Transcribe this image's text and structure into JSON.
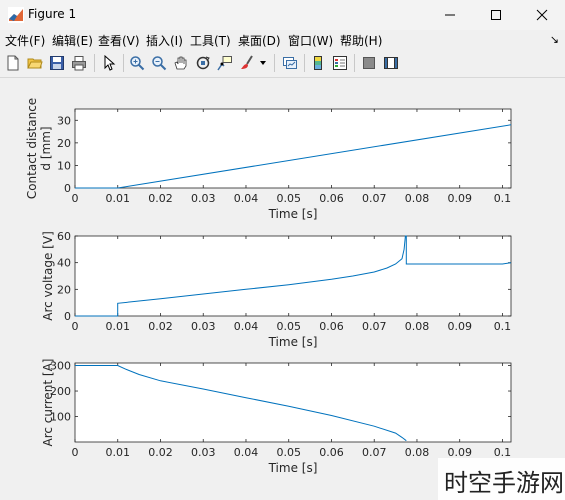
{
  "window": {
    "title": "Figure 1",
    "icon": "matlab-icon"
  },
  "menu": [
    "文件(F)",
    "编辑(E)",
    "查看(V)",
    "插入(I)",
    "工具(T)",
    "桌面(D)",
    "窗口(W)",
    "帮助(H)"
  ],
  "toolbar": [
    "new-figure-icon",
    "open-icon",
    "save-icon",
    "print-icon",
    "pointer-icon",
    "zoom-in-icon",
    "zoom-out-icon",
    "pan-icon",
    "rotate-icon",
    "data-cursor-icon",
    "brush-icon",
    "link-plot-icon",
    "colorbar-icon",
    "legend-icon",
    "hide-plot-tools-icon",
    "show-plot-tools-icon"
  ],
  "colors": {
    "line": "#0072bd",
    "axes_bg": "#ffffff",
    "figure_bg": "#f0f0f0"
  },
  "watermark": "时空手游网",
  "chart_data": [
    {
      "type": "line",
      "xlabel": "Time [s]",
      "ylabel": [
        "Contact distance",
        "d [mm]"
      ],
      "xlim": [
        0,
        0.102
      ],
      "ylim": [
        0,
        35
      ],
      "xticks": [
        "0",
        "0.01",
        "0.02",
        "0.03",
        "0.04",
        "0.05",
        "0.06",
        "0.07",
        "0.08",
        "0.09",
        "0.1"
      ],
      "yticks": [
        "0",
        "10",
        "20",
        "30"
      ],
      "x": [
        0,
        0.01,
        0.102
      ],
      "y": [
        0,
        0,
        28
      ]
    },
    {
      "type": "line",
      "xlabel": "Time [s]",
      "ylabel": [
        "Arc voltage [V]"
      ],
      "xlim": [
        0,
        0.102
      ],
      "ylim": [
        0,
        60
      ],
      "xticks": [
        "0",
        "0.01",
        "0.02",
        "0.03",
        "0.04",
        "0.05",
        "0.06",
        "0.07",
        "0.08",
        "0.09",
        "0.1"
      ],
      "yticks": [
        "0",
        "20",
        "40",
        "60"
      ],
      "x": [
        0,
        0.01,
        0.01,
        0.02,
        0.03,
        0.04,
        0.05,
        0.06,
        0.065,
        0.07,
        0.073,
        0.075,
        0.0765,
        0.077,
        0.0773,
        0.0775,
        0.0775,
        0.1,
        0.102
      ],
      "y": [
        0,
        0,
        9.5,
        13,
        16.5,
        20,
        23.5,
        27.5,
        30,
        33,
        36,
        39,
        43,
        50,
        60,
        60,
        39,
        39,
        40
      ]
    },
    {
      "type": "line",
      "xlabel": "Time [s]",
      "ylabel": [
        "Arc current [A]"
      ],
      "xlim": [
        0,
        0.102
      ],
      "ylim": [
        0,
        310
      ],
      "xticks": [
        "0",
        "0.01",
        "0.02",
        "0.03",
        "0.04",
        "0.05",
        "0.06",
        "0.07",
        "0.08",
        "0.09",
        "0.1"
      ],
      "yticks": [
        "100",
        "200",
        "300"
      ],
      "x": [
        0,
        0.01,
        0.012,
        0.015,
        0.02,
        0.03,
        0.04,
        0.05,
        0.06,
        0.07,
        0.075,
        0.0765,
        0.0775
      ],
      "y": [
        300,
        300,
        285,
        265,
        240,
        208,
        174,
        140,
        104,
        62,
        35,
        18,
        5
      ]
    }
  ]
}
